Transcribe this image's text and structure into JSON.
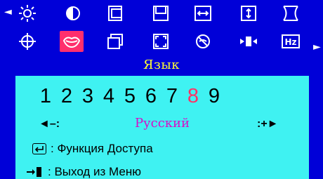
{
  "icons": {
    "row1": [
      "brightness-icon",
      "contrast-icon",
      "h-position-icon",
      "v-position-icon",
      "h-size-icon",
      "v-size-icon",
      "pincushion-icon"
    ],
    "row2": [
      "rotation-icon",
      "language-icon",
      "display-mode-icon",
      "zoom-icon",
      "degauss-icon",
      "moire-icon",
      "hz-icon"
    ],
    "selected": "language-icon",
    "hz_label": "Hz"
  },
  "section": {
    "title": "Язык"
  },
  "language": {
    "numbers": [
      "1",
      "2",
      "3",
      "4",
      "5",
      "6",
      "7",
      "8",
      "9"
    ],
    "active_index": 7,
    "minus_label": "◄–:",
    "plus_label": ":+►",
    "value": "Русский"
  },
  "footer": {
    "function_text": ": Функция Доступа",
    "exit_text": ": Выход из Меню"
  },
  "colors": {
    "background": "#0000d8",
    "panel": "#3ff2f2",
    "title": "#ffff33",
    "selected_icon": "#ff2f6d",
    "active_number": "#ff3366",
    "value_text": "#d60fc8"
  }
}
